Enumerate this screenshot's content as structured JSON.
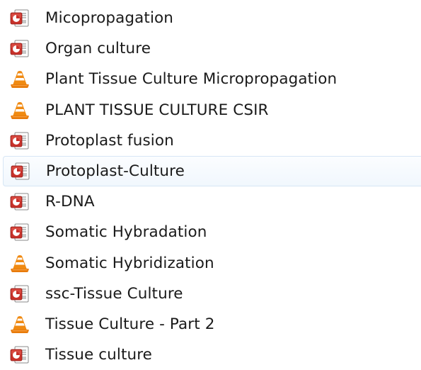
{
  "files": [
    {
      "name": "Micopropagation",
      "icon": "powerpoint-file-icon",
      "hovered": false
    },
    {
      "name": "Organ culture",
      "icon": "powerpoint-file-icon",
      "hovered": false
    },
    {
      "name": "Plant Tissue Culture  Micropropagation",
      "icon": "vlc-media-file-icon",
      "hovered": false
    },
    {
      "name": "PLANT TISSUE CULTURE CSIR",
      "icon": "vlc-media-file-icon",
      "hovered": false
    },
    {
      "name": "Protoplast fusion",
      "icon": "powerpoint-file-icon",
      "hovered": false
    },
    {
      "name": "Protoplast-Culture",
      "icon": "powerpoint-file-icon",
      "hovered": true
    },
    {
      "name": "R-DNA",
      "icon": "powerpoint-file-icon",
      "hovered": false
    },
    {
      "name": "Somatic Hybradation",
      "icon": "powerpoint-file-icon",
      "hovered": false
    },
    {
      "name": "Somatic Hybridization",
      "icon": "vlc-media-file-icon",
      "hovered": false
    },
    {
      "name": "ssc-Tissue Culture",
      "icon": "powerpoint-file-icon",
      "hovered": false
    },
    {
      "name": "Tissue Culture - Part 2",
      "icon": "vlc-media-file-icon",
      "hovered": false
    },
    {
      "name": "Tissue culture",
      "icon": "powerpoint-file-icon",
      "hovered": false
    }
  ],
  "colors": {
    "powerpoint_red": "#c8312a",
    "vlc_orange": "#f08a12",
    "hover_border": "#d7e6f5",
    "text": "#1a1a1a"
  }
}
